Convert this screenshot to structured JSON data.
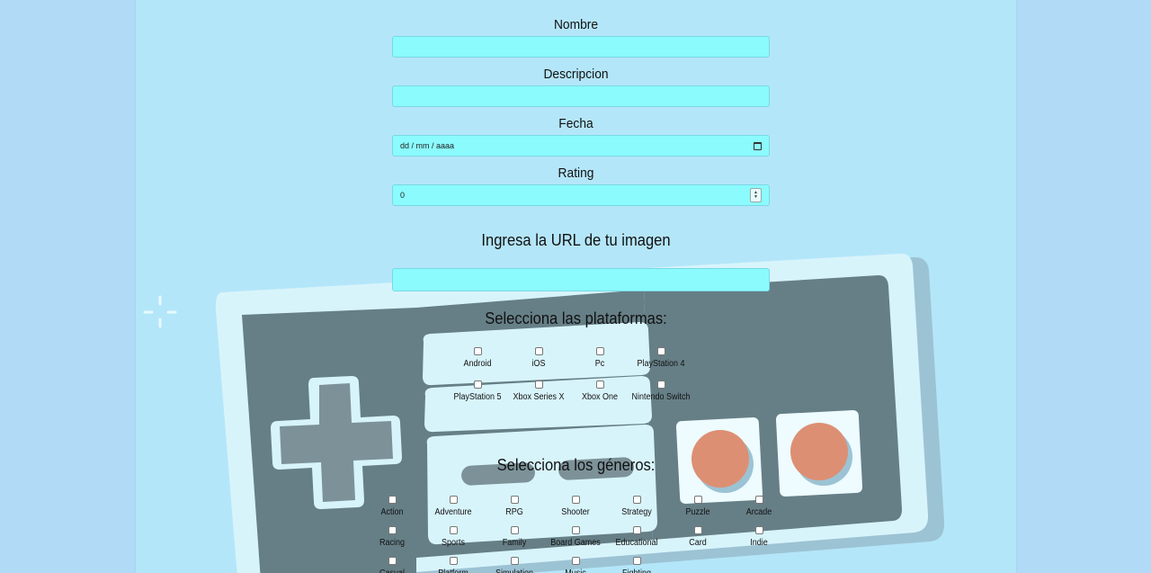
{
  "form": {
    "name_label": "Nombre",
    "name_value": "",
    "description_label": "Descripcion",
    "description_value": "",
    "date_label": "Fecha",
    "date_placeholder": "dd / mm / aaaa",
    "rating_label": "Rating",
    "rating_value": "0",
    "image_heading": "Ingresa la URL de tu imagen",
    "image_value": "",
    "platforms_heading": "Selecciona las plataformas:",
    "platforms": [
      "Android",
      "iOS",
      "Pc",
      "PlayStation 4",
      "PlayStation 5",
      "Xbox Series X",
      "Xbox One",
      "Nintendo Switch"
    ],
    "genres_heading": "Selecciona los géneros:",
    "genres": [
      "Action",
      "Adventure",
      "RPG",
      "Shooter",
      "Strategy",
      "Puzzle",
      "Arcade",
      "Racing",
      "Sports",
      "Family",
      "Board Games",
      "Educational",
      "Card",
      "Indie",
      "Casual",
      "Platform",
      "Simulation",
      "Music",
      "Fighting"
    ]
  },
  "colors": {
    "page_background": "#b0daf5",
    "panel_background": "#b4e6f9",
    "input_background": "#8bfbfd",
    "controller_body": "#d8f4fb",
    "controller_panel": "#667f86",
    "controller_button": "#dd8f73"
  }
}
